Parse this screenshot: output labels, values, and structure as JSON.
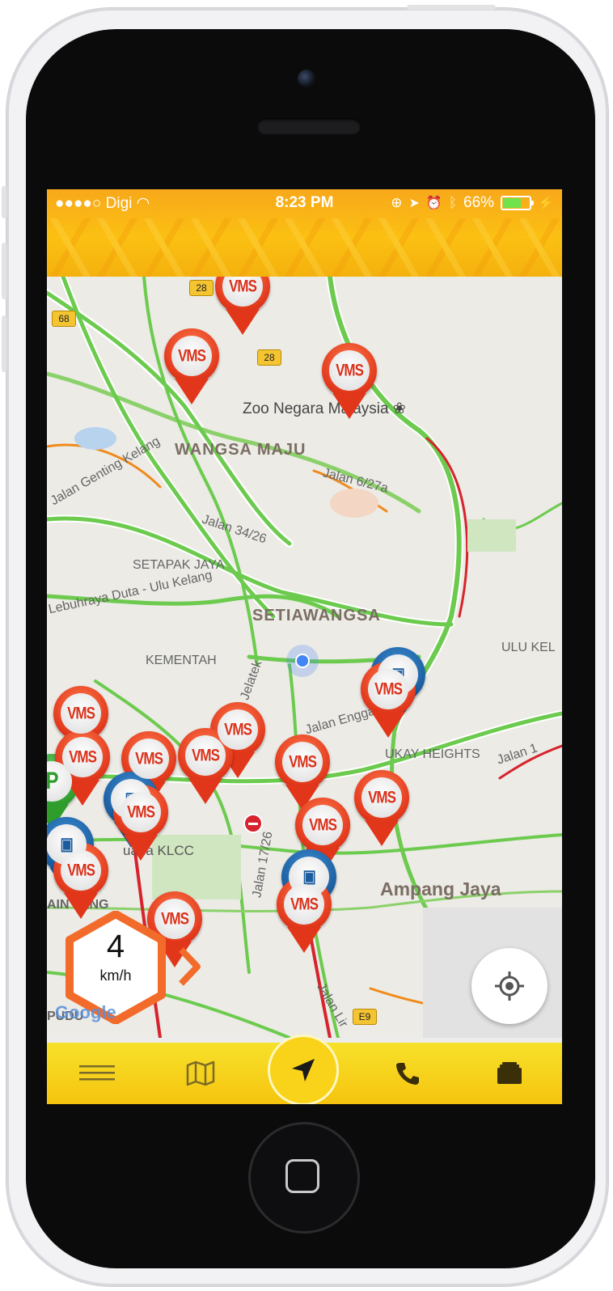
{
  "status_bar": {
    "carrier": "●●●●○ Digi",
    "time": "8:23 PM",
    "battery": "66%"
  },
  "map": {
    "districts": [
      "WANGSA MAJU",
      "SETAPAK JAYA",
      "SETIAWANGSA",
      "KEMENTAH",
      "UKAY HEIGHTS",
      "ULU KEL",
      "Ampang Jaya"
    ],
    "place": "Zoo Negara Malaysia",
    "roads": [
      "Jalan Genting Kelang",
      "Jalan 34/26",
      "Jalan 6/27a",
      "Lebuhraya Duta - Ulu Kelang",
      "Jalan Enggang",
      "Jalan 1",
      "Jalan 17/26",
      "Jalan Lir",
      "Jelatek",
      "uaria KLCC",
      "PUDU",
      "AIN JANG"
    ],
    "shields": [
      "28",
      "28",
      "68",
      "E9"
    ],
    "marker_label": "VMS",
    "parking_label": "P",
    "attribution": "Google"
  },
  "speedometer": {
    "value": "4",
    "unit": "km/h"
  },
  "colors": {
    "brand_yellow": "#F9D21A",
    "status_orange": "#F8A81A",
    "marker_red": "#E1361A",
    "traffic_green": "#6CCB4E",
    "traffic_red": "#D7232D"
  },
  "tab_bar": {
    "items": [
      {
        "icon": "menu-icon"
      },
      {
        "icon": "map-icon"
      },
      {
        "icon": "navigation-arrow-icon"
      },
      {
        "icon": "phone-icon"
      },
      {
        "icon": "briefcase-icon"
      }
    ]
  }
}
